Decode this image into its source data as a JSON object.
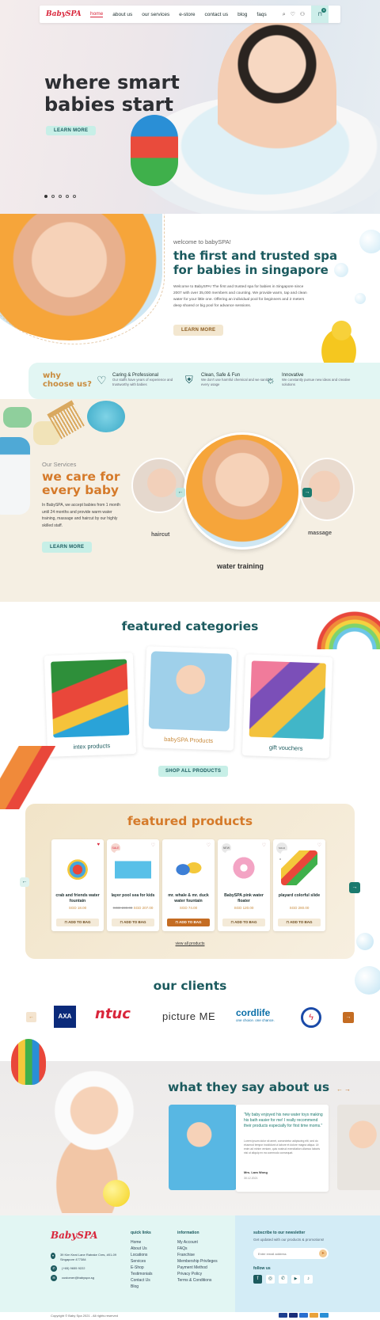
{
  "colors": {
    "brand": "#d9263b",
    "teal": "#1b5a5e",
    "accent": "#c98b3d",
    "mint": "#e2f6f3"
  },
  "nav": {
    "logo": "BabySPA",
    "items": [
      "home",
      "about us",
      "our services",
      "e-store",
      "contact us",
      "blog",
      "faqs"
    ],
    "cart_count": "0"
  },
  "hero": {
    "title_line1": "where smart",
    "title_line2": "babies start",
    "button": "LEARN MORE"
  },
  "welcome": {
    "kicker": "welcome to babySPA!",
    "title_line1": "the first and trusted spa",
    "title_line2": "for babies in singapore",
    "body": "Welcome to BabySPA! The first and trusted spa for babies in Singapore since 2007 with over 35,000 members and counting. We provide warm, tap and clean water for your little one. Offering an individual pool for beginners and 2 meters deep shared or big pool for advance sessions.",
    "button": "LEARN MORE"
  },
  "why": {
    "title_line1": "why",
    "title_line2": "choose us?",
    "items": [
      {
        "icon": "heart-icon",
        "title": "Caring & Professional",
        "desc": "Our staffs have years of experience and trustworthy with babies"
      },
      {
        "icon": "shield-icon",
        "title": "Clean, Safe & Fun",
        "desc": "We don't use harmful chemical and we sanitize every usage"
      },
      {
        "icon": "bulb-icon",
        "title": "Innovative",
        "desc": "We constantly pursue new ideas and creative solutions"
      }
    ]
  },
  "services": {
    "kicker": "Our Services",
    "title_line1": "we care for",
    "title_line2": "every baby",
    "body": "In BabySPA, we accept babies from 1 month until 24 months and provide warm water training, massage and haircut by our highly skilled staff.",
    "button": "LEARN MORE",
    "left": "haircut",
    "center": "water training",
    "right": "massage"
  },
  "categories": {
    "title": "featured categories",
    "items": [
      "intex products",
      "babySPA Products",
      "gift vouchers"
    ],
    "button": "SHOP ALL PRODUCTS"
  },
  "products": {
    "title": "featured products",
    "items": [
      {
        "name": "crab and friends water fountain",
        "price": "SGD 18.00",
        "old": "",
        "badge": ""
      },
      {
        "name": "layer pool sea for kids",
        "price": "SGD 207.00",
        "old": "SGD 230.00",
        "badge": "SALE"
      },
      {
        "name": "mr. whale & mr. duck water fountain",
        "price": "SGD 74.00",
        "old": "",
        "badge": ""
      },
      {
        "name": "BabySPA pink water floater",
        "price": "SGD 120.00",
        "old": "",
        "badge": "NEW"
      },
      {
        "name": "playard colorful slide",
        "price": "SGD 280.00",
        "old": "",
        "badge": "SOLD OUT"
      }
    ],
    "add_label": "ADD TO BAG",
    "view_all": "view all products"
  },
  "clients": {
    "title": "our clients",
    "logos": [
      "AXA",
      "ntuc",
      "picture ME",
      "cordlife",
      "one choice"
    ],
    "cordlife_tag": "one choice. one chance."
  },
  "testimonials": {
    "title": "what they say about us",
    "quote": "\"My baby enjoyed his new water toys making his bath easier for me! I really recommend their products especially for first time moms.\"",
    "body": "Lorem ipsum dolor sit amet, consectetur adipiscing elit, sed do eiusmod tempor incididunt ut labore et dolore magna aliqua. Ut enim ad minim veniam, quis nostrud exercitation ullamco laboris nisi ut aliquip ex ea commodo consequat.",
    "author": "Mrs. Lara Wong",
    "date": "30.12.2021"
  },
  "footer": {
    "logo": "BabySPA",
    "address": "39 Kim Keat Lane Ratrake Cres, #01-09 Singapore 477384",
    "phone": "(+65) 9655 9222",
    "email": "customer@babyspa.sg",
    "quick_title": "quick links",
    "quick": [
      "Home",
      "About Us",
      "Locations",
      "Services",
      "E-Shop",
      "Testimonials",
      "Contact Us",
      "Blog"
    ],
    "info_title": "information",
    "info": [
      "My Account",
      "FAQs",
      "Franchise",
      "Membership Privileges",
      "Payment Method",
      "Privacy Policy",
      "Terms & Conditions"
    ],
    "news_title": "subscribe to our newsletter",
    "news_sub": "Get updated with our products & promotions!",
    "news_placeholder": "Enter email address",
    "follow": "follow us",
    "copyright": "Copyright © Baby Spa 2021 - All rights reserved"
  }
}
